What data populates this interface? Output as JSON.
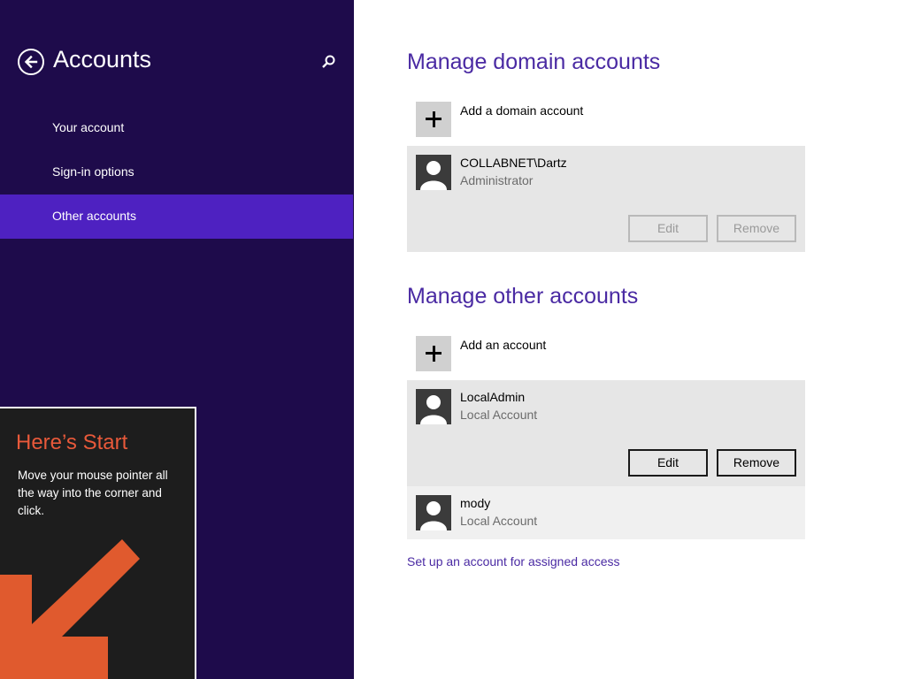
{
  "sidebar": {
    "title": "Accounts",
    "back_icon": "back-arrow-icon",
    "search_icon": "search-icon",
    "items": [
      {
        "label": "Your account"
      },
      {
        "label": "Sign-in options"
      },
      {
        "label": "Other accounts",
        "active": true
      }
    ],
    "bg_color": "#1e0b4b",
    "active_color": "#4e21c1"
  },
  "start_tip": {
    "title": "Here’s Start",
    "body": "Move your mouse pointer all the way into the corner and click.",
    "accent_color": "#e8593a"
  },
  "domain_section": {
    "title": "Manage domain accounts",
    "add_label": "Add a domain account",
    "accounts": [
      {
        "name": "COLLABNET\\Dartz",
        "type": "Administrator",
        "edit_label": "Edit",
        "remove_label": "Remove",
        "buttons_enabled": false
      }
    ]
  },
  "other_section": {
    "title": "Manage other accounts",
    "add_label": "Add an account",
    "accounts": [
      {
        "name": "LocalAdmin",
        "type": "Local Account",
        "edit_label": "Edit",
        "remove_label": "Remove",
        "buttons_enabled": true
      },
      {
        "name": "mody",
        "type": "Local Account"
      }
    ]
  },
  "assigned_access_link": "Set up an account for assigned access",
  "accent_color": "#4a2aa3"
}
